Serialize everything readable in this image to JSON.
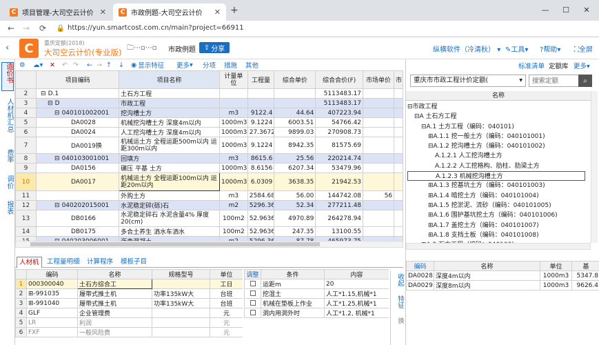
{
  "browser": {
    "tabs": [
      {
        "title": "项目管理-大司空云计价"
      },
      {
        "title": "市政例题-大司空云计价"
      }
    ],
    "new_tab": "+",
    "win": {
      "min": "—",
      "max": "☐",
      "close": "✕"
    },
    "url": "https://yun.smartcost.com.cn/main?project=66911"
  },
  "app": {
    "logo": "C",
    "region": "重庆定额(2018)",
    "name": "大司空云计价(专业版)",
    "project_title": "市政例题",
    "share": "分享",
    "user": "纵横软件（冷清秋）",
    "tools": "工具",
    "help": "帮助",
    "fullscreen": "全屏"
  },
  "leftnav": {
    "collapse": "‹",
    "items": [
      "造价书",
      "人材机汇总",
      "费率",
      "调价",
      "报表"
    ]
  },
  "toolbar": {
    "show_features": "显示特征",
    "more": "更多",
    "split": "分项",
    "measures": "措施",
    "other": "其他",
    "std_list": "标准清单",
    "quota_lib": "定额库",
    "more2": "更多"
  },
  "grid": {
    "columns": [
      "项目编码",
      "项目名称",
      "计量单位",
      "工程量",
      "综合单价",
      "综合合价(F)",
      "市场单价",
      "市"
    ],
    "rows": [
      {
        "n": "2",
        "tree": "⊟",
        "code": "D.1",
        "name": "土石方工程",
        "unit": "",
        "qty": "",
        "price": "",
        "total": "5113483.17",
        "mkt": "",
        "kind": "plain"
      },
      {
        "n": "3",
        "tree": "⊟",
        "code": "D",
        "name": "市政工程",
        "unit": "",
        "qty": "",
        "price": "",
        "total": "5113483.17",
        "mkt": "",
        "kind": "grp"
      },
      {
        "n": "4",
        "tree": "⊟",
        "code": "040101002001",
        "name": "挖沟槽土方",
        "unit": "m3",
        "qty": "9122.4",
        "price": "44.64",
        "total": "407223.94",
        "mkt": "",
        "kind": "grp"
      },
      {
        "n": "5",
        "tree": "",
        "code": "DA0028",
        "name": "机械挖沟槽土方 深度4m以内",
        "unit": "1000m3",
        "qty": "9.1224",
        "price": "6003.51",
        "total": "54766.42",
        "mkt": "",
        "kind": "plain"
      },
      {
        "n": "6",
        "tree": "",
        "code": "DA0024",
        "name": "人工挖沟槽土方 深度4m以内",
        "unit": "1000m3",
        "qty": "27.3672",
        "price": "9899.03",
        "total": "270908.73",
        "mkt": "",
        "kind": "plain"
      },
      {
        "n": "7",
        "tree": "",
        "code": "DA0019换",
        "name": "机械运土方 全程运距500m以内 运距300m以内",
        "unit": "1000m3",
        "qty": "9.1224",
        "price": "8942.35",
        "total": "81575.69",
        "mkt": "",
        "kind": "tall"
      },
      {
        "n": "8",
        "tree": "⊟",
        "code": "040103001001",
        "name": "回填方",
        "unit": "m3",
        "qty": "8615.6",
        "price": "25.56",
        "total": "220214.74",
        "mkt": "",
        "kind": "grp"
      },
      {
        "n": "9",
        "tree": "",
        "code": "DA0156",
        "name": "碾压 平基 土方",
        "unit": "1000m3",
        "qty": "8.6156",
        "price": "6207.34",
        "total": "53479.96",
        "mkt": "",
        "kind": "plain"
      },
      {
        "n": "10",
        "tree": "",
        "code": "DA0017",
        "name": "机械运土方 全程运距100m以内 运距20m以内",
        "unit": "1000m3",
        "qty": "6.0309",
        "price": "3638.35",
        "total": "21942.53",
        "mkt": "",
        "kind": "sel"
      },
      {
        "n": "11",
        "tree": "",
        "code": "",
        "name": "外购土方",
        "unit": "m3",
        "qty": "2584.68",
        "price": "56.00",
        "total": "144742.08",
        "mkt": "56",
        "kind": "plain"
      },
      {
        "n": "12",
        "tree": "⊟",
        "code": "040202015001",
        "name": "水泥稳定碎(砾)石",
        "unit": "m2",
        "qty": "5296.36",
        "price": "52.34",
        "total": "277211.48",
        "mkt": "",
        "kind": "grp"
      },
      {
        "n": "13",
        "tree": "",
        "code": "DB0166",
        "name": "水泥稳定碎石 水泥含量4% 厚度20(cm)",
        "unit": "100m2",
        "qty": "52.9636",
        "price": "4970.89",
        "total": "264278.94",
        "mkt": "",
        "kind": "tall"
      },
      {
        "n": "14",
        "tree": "",
        "code": "DB0175",
        "name": "多合土养生 洒水车洒水",
        "unit": "100m2",
        "qty": "52.9636",
        "price": "247.35",
        "total": "13100.55",
        "mkt": "",
        "kind": "plain"
      },
      {
        "n": "15",
        "tree": "⊟",
        "code": "040203006001",
        "name": "沥青混凝土",
        "unit": "m2",
        "qty": "5296.36",
        "price": "87.78",
        "total": "465973.75",
        "mkt": "",
        "kind": "grp"
      }
    ]
  },
  "bottom": {
    "tabs": [
      "人材机",
      "工程量明细",
      "计算程序",
      "模板子目"
    ],
    "columns": [
      "编码",
      "名称",
      "规格型号",
      "单位"
    ],
    "rows": [
      {
        "n": "1",
        "code": "000300040",
        "name": "土石方综合工",
        "spec": "",
        "unit": "工日"
      },
      {
        "n": "2",
        "code": "⊞-991035",
        "name": "履带式推土机",
        "spec": "功率135kW大",
        "unit": "台班"
      },
      {
        "n": "3",
        "code": "⊞-991040",
        "name": "履带式推土机",
        "spec": "功率135kW大",
        "unit": "台班"
      },
      {
        "n": "4",
        "code": "GLF",
        "name": "企业管理费",
        "spec": "",
        "unit": "元"
      },
      {
        "n": "5",
        "code": "LR",
        "name": "利润",
        "spec": "",
        "unit": "元"
      },
      {
        "n": "6",
        "code": "FXF",
        "name": "一般风险费",
        "spec": "",
        "unit": "元"
      }
    ],
    "adj_columns": [
      "调整",
      "条件",
      "内容"
    ],
    "adj_rows": [
      {
        "cond": "运距m",
        "content": "20"
      },
      {
        "cond": "挖湿土",
        "content": "人工*1.15,机械*1"
      },
      {
        "cond": "机械在垫板上作业",
        "content": "人工*1.25,机械*1"
      },
      {
        "cond": "洞内用洞外时",
        "content": "人工*1.2, 机械*1"
      }
    ],
    "side": [
      "收起",
      "特征",
      "换"
    ]
  },
  "right": {
    "lib": "重庆市市政工程计价定额(",
    "search_ph": "搜索定额",
    "name_col": "名称",
    "tree": [
      {
        "lv": 0,
        "t": "⊟市政工程"
      },
      {
        "lv": 1,
        "t": "⊟A 土石方工程"
      },
      {
        "lv": 2,
        "t": "⊟A.1 土方工程（编码：040101)"
      },
      {
        "lv": 3,
        "t": "⊞A.1.1 挖一般土方（编码：040101001)"
      },
      {
        "lv": 3,
        "t": "⊟A.1.2 挖沟槽土方（编码：040101002)"
      },
      {
        "lv": 4,
        "t": "A.1.2.1 人工挖沟槽土方"
      },
      {
        "lv": 4,
        "t": "A.1.2.2 人工挖格构、肋柱、肋梁土方"
      },
      {
        "lv": 4,
        "t": "A.1.2.3 机械挖沟槽土方"
      },
      {
        "lv": 3,
        "t": "⊞A.1.3 挖基坑土方（编码：040101003)"
      },
      {
        "lv": 3,
        "t": "⊞A.1.4 暗挖土方（编码：040101004)"
      },
      {
        "lv": 3,
        "t": "⊞A.1.5 挖淤泥、流砂（编码：040101005)"
      },
      {
        "lv": 3,
        "t": "⊞A.1.6 围护基坑挖土方（编码：040101006)"
      },
      {
        "lv": 3,
        "t": "⊞A.1.7 盖挖土方（编码：040101007)"
      },
      {
        "lv": 3,
        "t": "⊞A.1.8 支挡土板（编码：040101008)"
      },
      {
        "lv": 2,
        "t": "⊞A.2 石方工程（编码：040102)"
      }
    ],
    "columns": [
      "编码",
      "名称",
      "单位",
      "基"
    ],
    "rows": [
      {
        "code": "DA0028",
        "name": "深度4m以内",
        "unit": "1000m3",
        "price": "5347.8"
      },
      {
        "code": "DA0029",
        "name": "深度8m以内",
        "unit": "1000m3",
        "price": "9626.4"
      }
    ]
  }
}
